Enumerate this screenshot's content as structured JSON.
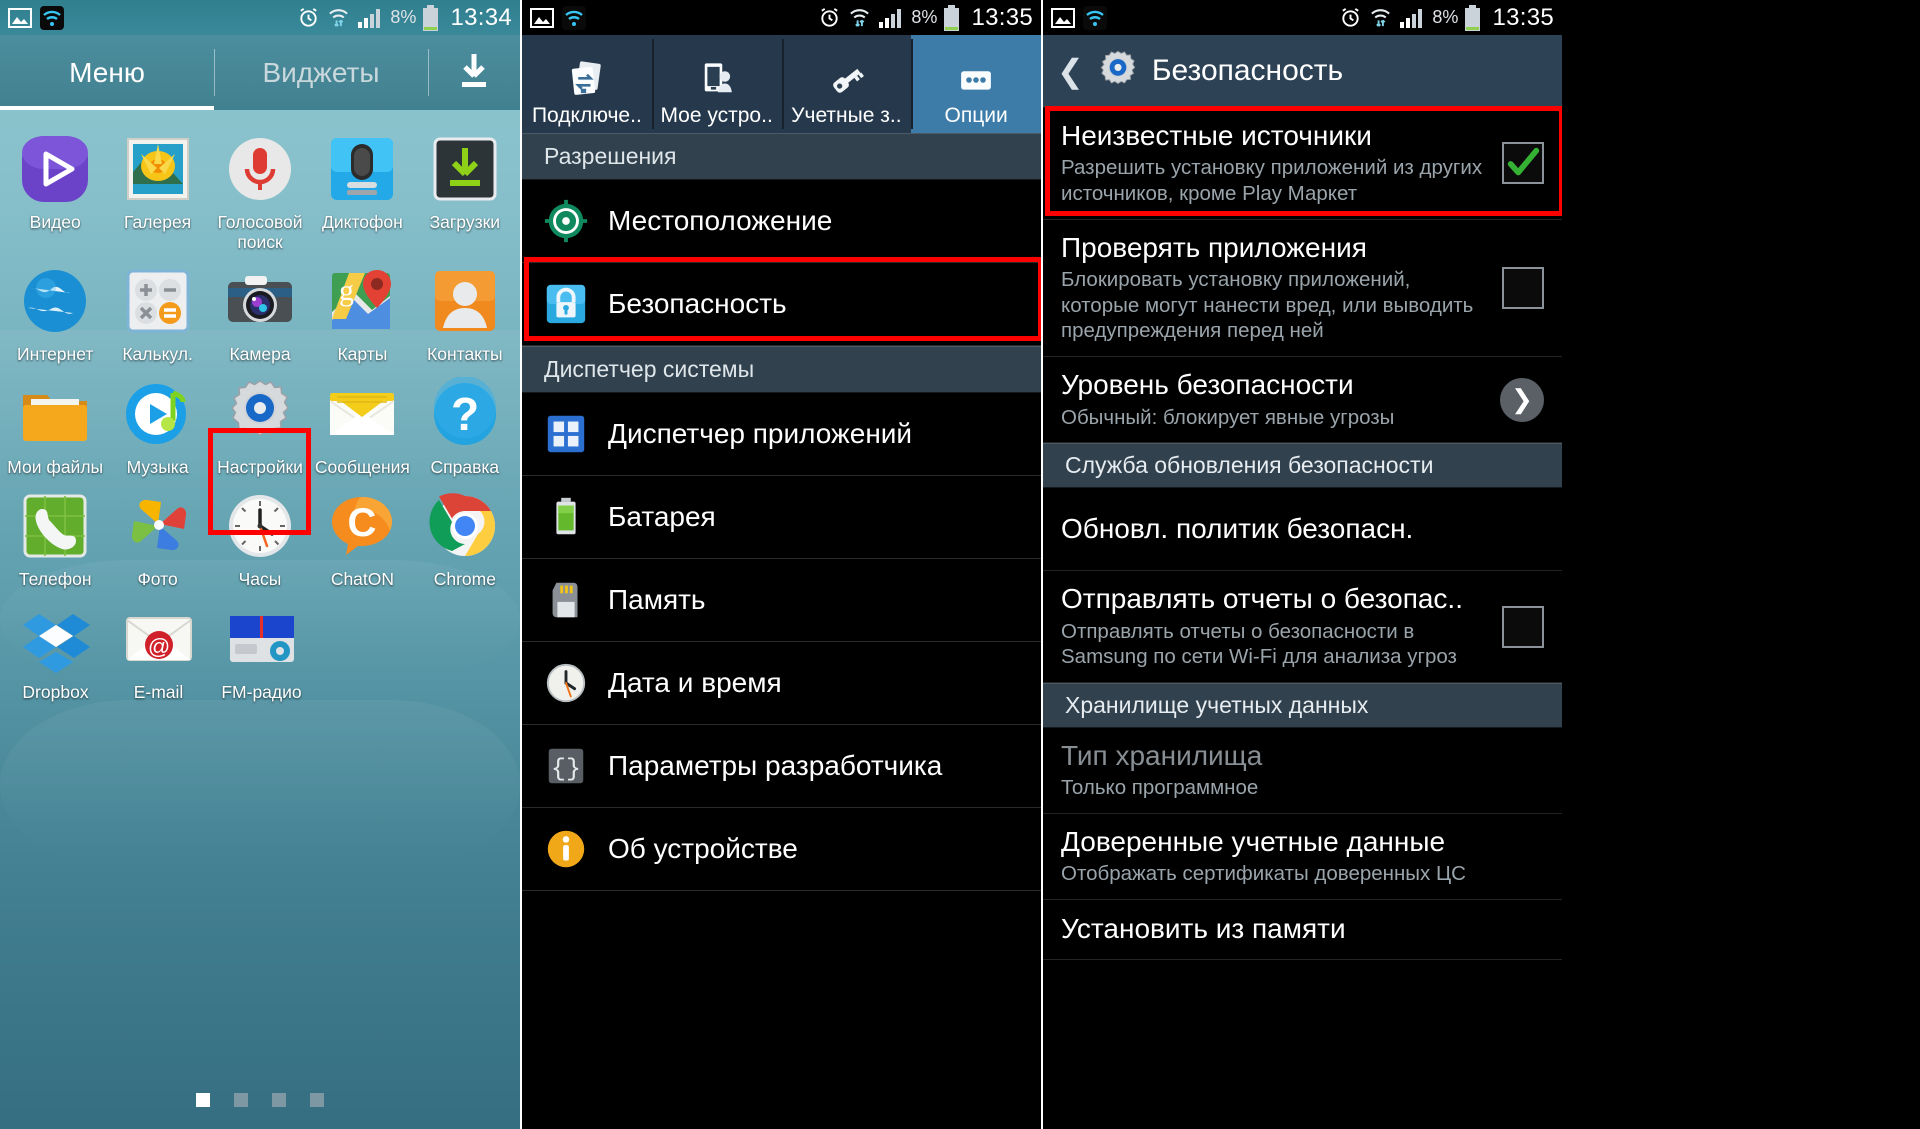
{
  "status_bar": {
    "time_left": "13:34",
    "time_mid": "13:35",
    "time_right": "13:35",
    "battery_percent": "8%",
    "icons": [
      "image-icon",
      "wifi-icon",
      "alarm-icon",
      "wifi-transfer-icon",
      "signal-icon",
      "battery-icon"
    ]
  },
  "panel1": {
    "tabs": [
      {
        "label": "Меню",
        "active": true
      },
      {
        "label": "Виджеты",
        "active": false
      }
    ],
    "download_icon": "download-icon",
    "apps": [
      [
        {
          "label": "Видео",
          "icon": "video-icon"
        },
        {
          "label": "Галерея",
          "icon": "gallery-icon"
        },
        {
          "label": "Голосовой поиск",
          "icon": "voice-search-icon"
        },
        {
          "label": "Диктофон",
          "icon": "voice-recorder-icon"
        },
        {
          "label": "Загрузки",
          "icon": "downloads-icon"
        }
      ],
      [
        {
          "label": "Интернет",
          "icon": "internet-icon"
        },
        {
          "label": "Калькул.",
          "icon": "calculator-icon"
        },
        {
          "label": "Камера",
          "icon": "camera-icon"
        },
        {
          "label": "Карты",
          "icon": "maps-icon"
        },
        {
          "label": "Контакты",
          "icon": "contacts-icon"
        }
      ],
      [
        {
          "label": "Мои файлы",
          "icon": "files-icon"
        },
        {
          "label": "Музыка",
          "icon": "music-icon"
        },
        {
          "label": "Настройки",
          "icon": "settings-icon",
          "highlighted": true
        },
        {
          "label": "Сообщения",
          "icon": "messages-icon"
        },
        {
          "label": "Справка",
          "icon": "help-icon"
        }
      ],
      [
        {
          "label": "Телефон",
          "icon": "phone-icon"
        },
        {
          "label": "Фото",
          "icon": "photos-icon"
        },
        {
          "label": "Часы",
          "icon": "clock-icon"
        },
        {
          "label": "ChatON",
          "icon": "chaton-icon"
        },
        {
          "label": "Chrome",
          "icon": "chrome-icon"
        }
      ],
      [
        {
          "label": "Dropbox",
          "icon": "dropbox-icon"
        },
        {
          "label": "E-mail",
          "icon": "email-icon"
        },
        {
          "label": "FM-радио",
          "icon": "fm-radio-icon"
        }
      ]
    ],
    "page_dots": {
      "count": 4,
      "active_index": 0
    }
  },
  "panel2": {
    "tabs": [
      {
        "label": "Подключе..",
        "icon": "connections-icon",
        "active": false
      },
      {
        "label": "Мое устро..",
        "icon": "my-device-icon",
        "active": false
      },
      {
        "label": "Учетные з..",
        "icon": "accounts-icon",
        "active": false
      },
      {
        "label": "Опции",
        "icon": "more-icon",
        "active": true
      }
    ],
    "sections": [
      {
        "header": "Разрешения",
        "items": [
          {
            "label": "Местоположение",
            "icon": "location-icon",
            "highlighted": false
          },
          {
            "label": "Безопасность",
            "icon": "security-lock-icon",
            "highlighted": true
          }
        ]
      },
      {
        "header": "Диспетчер системы",
        "items": [
          {
            "label": "Диспетчер приложений",
            "icon": "app-manager-icon",
            "highlighted": false
          },
          {
            "label": "Батарея",
            "icon": "battery-icon",
            "highlighted": false
          },
          {
            "label": "Память",
            "icon": "storage-icon",
            "highlighted": false
          },
          {
            "label": "Дата и время",
            "icon": "date-time-icon",
            "highlighted": false
          },
          {
            "label": "Параметры разработчика",
            "icon": "developer-icon",
            "highlighted": false
          },
          {
            "label": "Об устройстве",
            "icon": "about-device-icon",
            "highlighted": false
          }
        ]
      }
    ]
  },
  "panel3": {
    "back_icon": "back-chevron-icon",
    "title_icon": "settings-gear-icon",
    "title": "Безопасность",
    "rows": [
      {
        "type": "checkbox",
        "title": "Неизвестные источники",
        "subtitle": "Разрешить установку приложений из других источников, кроме Play Маркет",
        "checked": true,
        "highlighted": true
      },
      {
        "type": "checkbox",
        "title": "Проверять приложения",
        "subtitle": "Блокировать установку приложений, которые могут нанести вред, или выводить предупреждения перед ней",
        "checked": false,
        "highlighted": false
      },
      {
        "type": "chevron",
        "title": "Уровень безопасности",
        "subtitle": "Обычный: блокирует явные угрозы",
        "highlighted": false
      },
      {
        "type": "header",
        "title": "Служба обновления безопасности"
      },
      {
        "type": "plain",
        "title": "Обновл. политик безопасн.",
        "subtitle": ""
      },
      {
        "type": "checkbox",
        "title": "Отправлять отчеты о безопас..",
        "subtitle": "Отправлять отчеты о безопасности в Samsung по сети Wi-Fi для анализа угроз",
        "checked": false,
        "highlighted": false
      },
      {
        "type": "header",
        "title": "Хранилище учетных данных"
      },
      {
        "type": "disabled",
        "title": "Тип хранилища",
        "subtitle": "Только программное"
      },
      {
        "type": "plain",
        "title": "Доверенные учетные данные",
        "subtitle": "Отображать сертификаты доверенных ЦС"
      },
      {
        "type": "plain",
        "title": "Установить из памяти",
        "subtitle": ""
      }
    ]
  },
  "colors": {
    "highlight_red": "#ff0000",
    "accent_blue": "#3d7ca8",
    "check_green": "#35b234",
    "panel_bg": "#000000"
  }
}
